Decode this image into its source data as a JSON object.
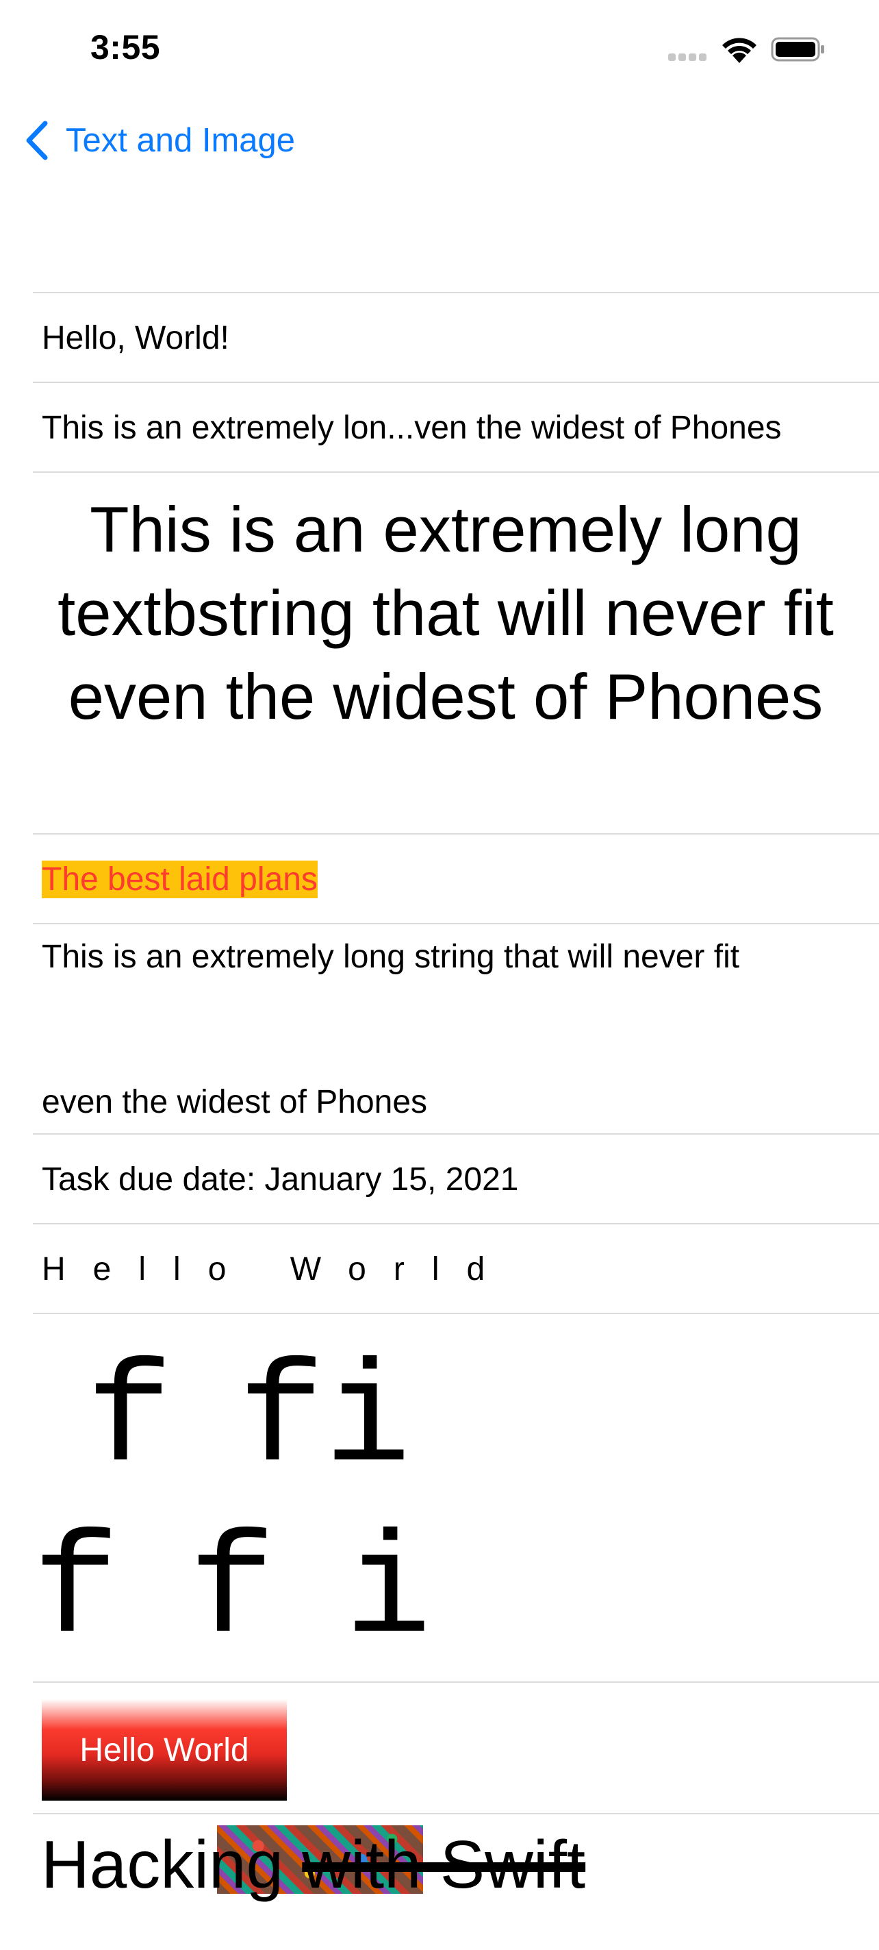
{
  "status_bar": {
    "time": "3:55"
  },
  "nav": {
    "back_label": "Text and Image"
  },
  "rows": {
    "hello": "Hello, World!",
    "truncated": "This is an extremely lon...ven the widest of Phones",
    "big": "This is an extremely long textbstring that will never fit even the widest of Phones",
    "highlight": "The best laid plans",
    "multiline_line1": "This is an extremely long string that will never fit",
    "multiline_line2": "even the widest of Phones",
    "due_date": "Task due date: January 15, 2021",
    "kerned": "Hello World",
    "ligature_top_1": "f",
    "ligature_top_2": "fi",
    "ligature_bottom_1": "f",
    "ligature_bottom_2": "f",
    "ligature_bottom_3": "i",
    "gradient_button": "Hello World",
    "hws_part1": "Hacking ",
    "hws_part2": "with Swift"
  },
  "colors": {
    "accent": "#0a7aff",
    "highlight_bg": "#fec20a",
    "highlight_text": "#fd3b2f",
    "separator": "#dcdcdc"
  },
  "icons": [
    "chevron-left-icon",
    "cellular-signal-icon",
    "wifi-icon",
    "battery-icon"
  ]
}
